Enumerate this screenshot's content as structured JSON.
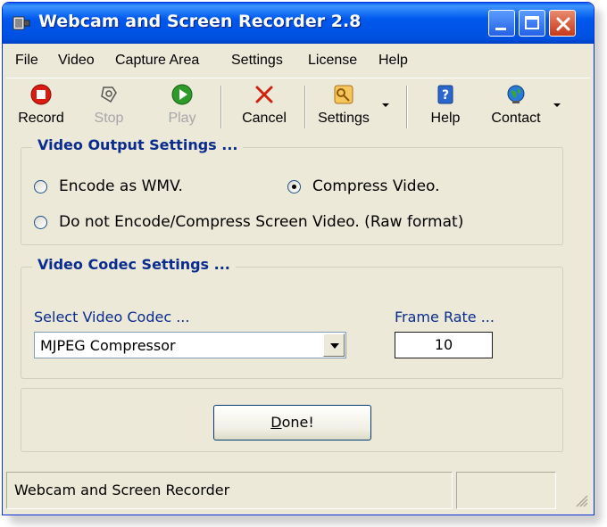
{
  "window": {
    "title": "Webcam and Screen Recorder 2.8"
  },
  "menu": {
    "items": [
      "File",
      "Video",
      "Capture Area",
      "Settings",
      "License",
      "Help"
    ]
  },
  "toolbar": {
    "record": "Record",
    "stop": "Stop",
    "play": "Play",
    "cancel": "Cancel",
    "settings": "Settings",
    "help": "Help",
    "contact": "Contact"
  },
  "video_output": {
    "title": "Video Output Settings ...",
    "options": [
      {
        "label": "Encode as WMV.",
        "checked": false
      },
      {
        "label": "Compress Video.",
        "checked": true
      },
      {
        "label": "Do not Encode/Compress Screen Video. (Raw format)",
        "checked": false
      }
    ]
  },
  "video_codec": {
    "title": "Video Codec Settings ...",
    "codec_label": "Select Video Codec ...",
    "codec_value": "MJPEG Compressor",
    "frame_rate_label": "Frame Rate ...",
    "frame_rate_value": "10"
  },
  "done": {
    "mnemonic": "D",
    "rest": "one!"
  },
  "status": {
    "text": "Webcam and Screen Recorder"
  },
  "colors": {
    "titlebar": "#0058ee",
    "group_title": "#0a2c8e",
    "window_bg": "#ece9d8"
  }
}
